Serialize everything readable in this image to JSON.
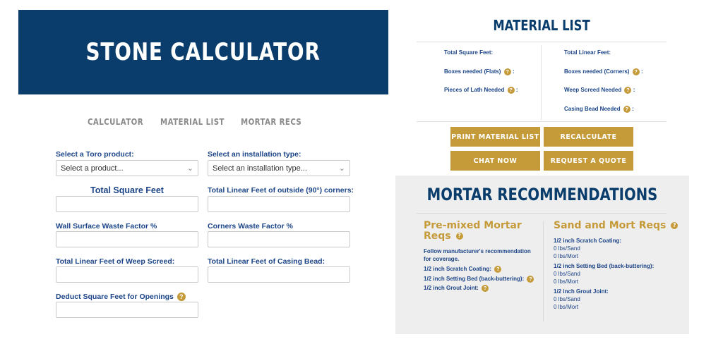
{
  "header": {
    "title": "STONE CALCULATOR"
  },
  "tabs": [
    {
      "label": "CALCULATOR"
    },
    {
      "label": "MATERIAL LIST"
    },
    {
      "label": "MORTAR RECS"
    }
  ],
  "form": {
    "product_label": "Select a Toro product:",
    "product_value": "Select a product...",
    "install_label": "Select an installation type:",
    "install_value": "Select an installation type...",
    "total_sqft_label": "Total Square Feet",
    "corners_label": "Total Linear Feet of outside (90°) corners:",
    "wall_waste_label": "Wall Surface Waste Factor %",
    "corners_waste_label": "Corners Waste Factor %",
    "weep_label": "Total Linear Feet of Weep Screed:",
    "casing_label": "Total Linear Feet of Casing Bead:",
    "openings_label": "Deduct Square Feet for Openings"
  },
  "help_glyph": "?",
  "material_list": {
    "title": "MATERIAL LIST",
    "left": {
      "total_sqft": "Total Square Feet:",
      "boxes_flats": "Boxes needed (Flats)",
      "lath": "Pieces of Lath Needed"
    },
    "right": {
      "total_linear": "Total Linear Feet:",
      "boxes_corners": "Boxes needed (Corners)",
      "weep": "Weep Screed Needed",
      "casing": "Casing Bead Needed"
    },
    "colon": ":",
    "buttons": {
      "print": "PRINT MATERIAL LIST",
      "recalculate": "RECALCULATE",
      "chat": "CHAT NOW",
      "quote": "REQUEST A QUOTE"
    }
  },
  "mortar": {
    "title": "MORTAR RECOMMENDATIONS",
    "premixed": {
      "heading_line1": "Pre-mixed Mortar",
      "heading_line2": "Reqs",
      "note_line1": "Follow manufacturer's recommendation",
      "note_line2": "for coverage.",
      "scratch": "1/2 inch Scratch Coating:",
      "setting": "1/2 inch Setting Bed (back-buttering):",
      "grout": "1/2 inch Grout Joint:"
    },
    "sand": {
      "heading": "Sand and Mort Reqs",
      "scratch": "1/2 inch Scratch Coating:",
      "scratch_sand": "0 lbs/Sand",
      "scratch_mort": "0 lbs/Mort",
      "setting": "1/2 inch Setting Bed (back-buttering):",
      "setting_sand": "0 lbs/Sand",
      "setting_mort": "0 lbs/Mort",
      "grout": "1/2 inch Grout Joint:",
      "grout_sand": "0 lbs/Sand",
      "grout_mort": "0 lbs/Mort"
    }
  },
  "colors": {
    "navy": "#0a3d6b",
    "gold": "#c59b3a",
    "label_blue": "#1c4587",
    "tab_grey": "#8a8a8a",
    "panel_grey": "#eeeeee"
  }
}
